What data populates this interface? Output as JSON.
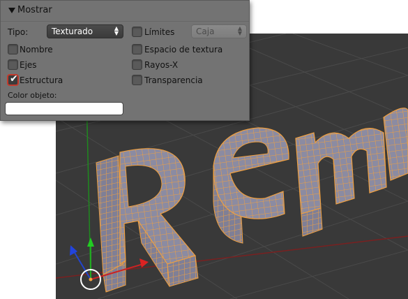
{
  "panel": {
    "header": "Mostrar",
    "tipo_label": "Tipo:",
    "tipo_value": "Texturado",
    "limites_label": "Límites",
    "limites_checked": false,
    "limites_value": "Caja",
    "left_options": [
      {
        "label": "Nombre",
        "checked": false
      },
      {
        "label": "Ejes",
        "checked": false
      },
      {
        "label": "Estructura",
        "checked": true
      }
    ],
    "right_options": [
      {
        "label": "Espacio de textura",
        "checked": false
      },
      {
        "label": "Rayos-X",
        "checked": false
      },
      {
        "label": "Transparencia",
        "checked": false
      }
    ],
    "color_label": "Color objeto:",
    "color_value": "#ffffff"
  },
  "viewport": {
    "background": "#393939",
    "grid_color": "#4a4a4a",
    "wireframe_color": "#f0a040",
    "object_fill": "#8a8aa0",
    "axis_colors": {
      "x": "#cc2222",
      "y": "#22aa22",
      "z": "#2244cc"
    }
  }
}
